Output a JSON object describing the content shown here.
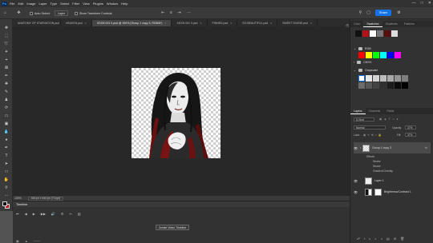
{
  "menu": [
    "File",
    "Edit",
    "Image",
    "Layer",
    "Type",
    "Select",
    "Filter",
    "View",
    "Plugins",
    "Window",
    "Help"
  ],
  "app_logo": "Ps",
  "options": {
    "auto_select_label": "Auto-Select:",
    "auto_select_value": "Layer",
    "transform_label": "Show Transform Controls",
    "share_label": "Share"
  },
  "tabs": [
    {
      "label": "ANATOMY OF STARVATION.psd",
      "active": false
    },
    {
      "label": "HEAVEN.psd",
      "active": false
    },
    {
      "label": "XDXN 001 0.psd @ 100% (Group 1 copy 3, RGB/8*)",
      "active": true
    },
    {
      "label": "XDXN 001 0.psd",
      "active": false
    },
    {
      "label": "FINNED.psd",
      "active": false
    },
    {
      "label": "SO BEAUTIFUL.psd",
      "active": false
    },
    {
      "label": "SWEET DIVINE.psd",
      "active": false
    }
  ],
  "status": {
    "zoom": "100%",
    "doc_info": "444 px x 444 px (72 ppi)"
  },
  "timeline": {
    "title": "Timeline",
    "create_button": "Create Video Timeline"
  },
  "swatches_panel": {
    "tabs": [
      "Color",
      "Swatches",
      "Gradients",
      "Patterns"
    ],
    "active_tab": 1,
    "groups": [
      "RGB",
      "CMYK",
      "Grayscale"
    ],
    "rgb_colors": [
      "#ff0000",
      "#ffff00",
      "#00ff00",
      "#00ffff",
      "#0000ff",
      "#ff00ff"
    ],
    "gray_colors": [
      "#ffffff",
      "#e6e6e6",
      "#d2d2d2",
      "#bdbdbd",
      "#a8a8a8",
      "#939393",
      "#7e7e7e"
    ],
    "gray_colors_row2": [
      "#6b6b6b",
      "#575757",
      "#434343",
      "#303030",
      "#1c1c1c",
      "#0a0a0a",
      "#000000"
    ]
  },
  "layers_panel": {
    "tabs": [
      "Layers",
      "Channels",
      "Paths"
    ],
    "active_tab": 0,
    "kind_label": "Kind",
    "blend_mode": "Normal",
    "opacity_label": "Opacity:",
    "opacity_value": "37%",
    "lock_label": "Lock:",
    "fill_label": "Fill:",
    "fill_value": "37%",
    "layers": [
      {
        "name": "Group 1 copy 3",
        "selected": true,
        "effects_label": "Effects",
        "effects": [
          "Stroke",
          "Stroke",
          "Gradient Overlay"
        ]
      },
      {
        "name": "Layer 1",
        "selected": false
      },
      {
        "name": "Brightness/Contrast 1",
        "selected": false
      }
    ]
  },
  "colors": {
    "accent": "#1473e6",
    "foreground": "#111111",
    "background": "#b3121a"
  }
}
